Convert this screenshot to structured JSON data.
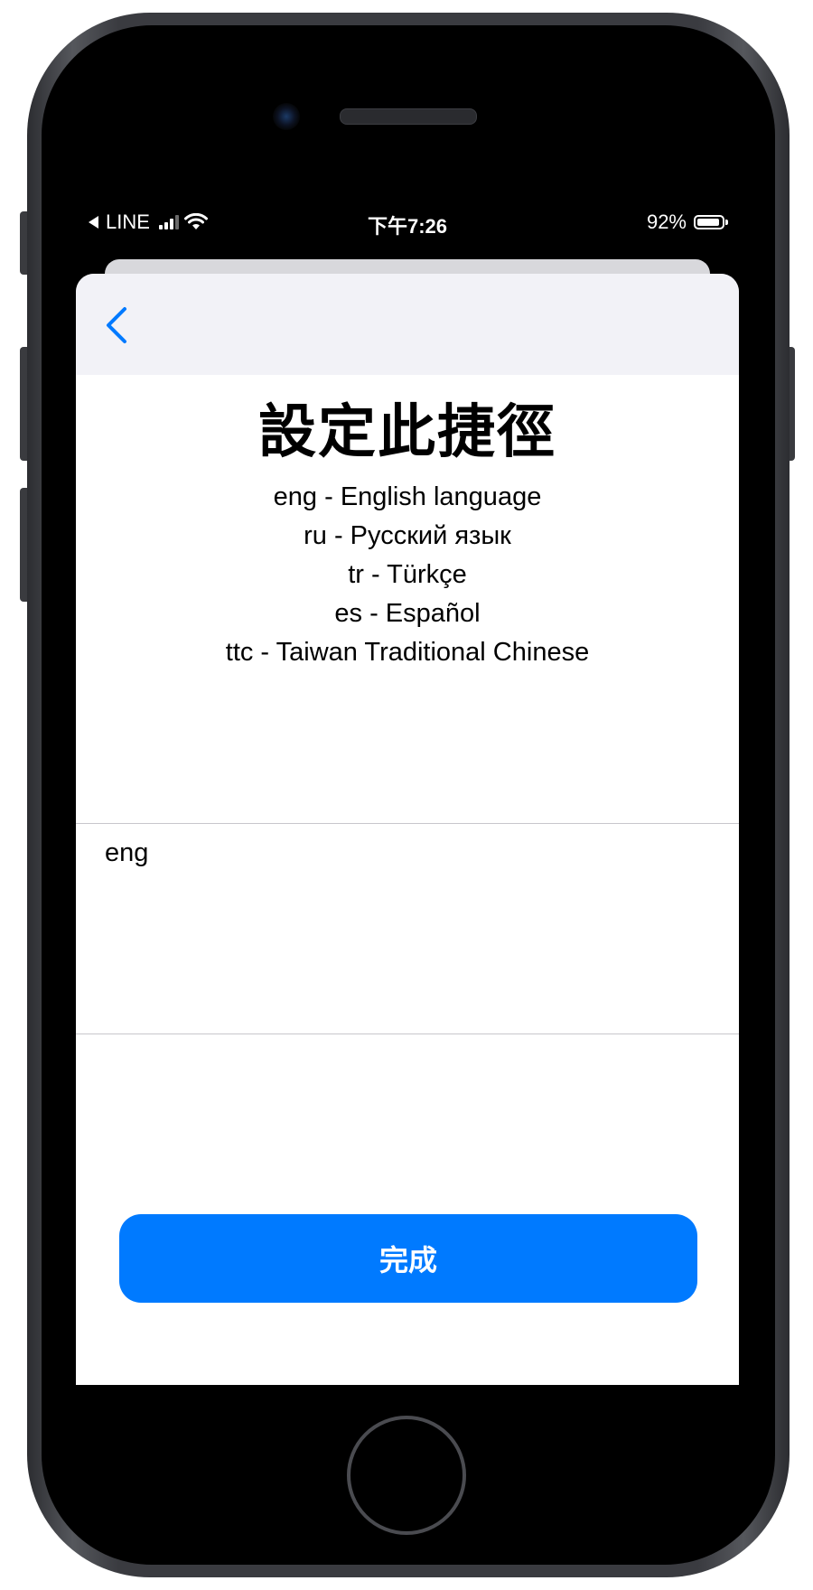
{
  "status_bar": {
    "carrier": "LINE",
    "time": "下午7:26",
    "battery_percent_text": "92%",
    "battery_level": 0.92
  },
  "sheet": {
    "title": "設定此捷徑",
    "description_lines": [
      "eng - English language",
      "ru - Русский язык",
      "tr - Türkçe",
      "es - Español",
      "ttc - Taiwan Traditional Chinese"
    ],
    "input_value": "eng",
    "done_label": "完成"
  },
  "colors": {
    "accent": "#007aff",
    "nav_background": "#f2f2f7",
    "divider": "#c8c7cc"
  },
  "icons": {
    "nav_back": "chevron-left-icon",
    "status_back": "back-arrow-icon",
    "signal": "cellular-signal-icon",
    "wifi": "wifi-icon",
    "battery": "battery-icon"
  }
}
